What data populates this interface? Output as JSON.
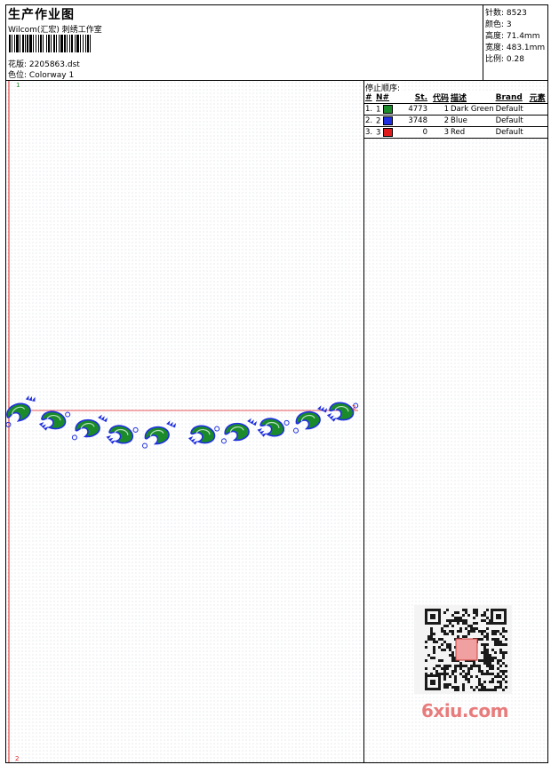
{
  "header": {
    "title": "生产作业图",
    "company": "Wilcom(汇宏) 刺绣工作室",
    "design_label": "花版:",
    "design_value": "2205863.dst",
    "colorway_label": "色位:",
    "colorway_value": "Colorway 1"
  },
  "stats": {
    "stitches": "针数: 8523",
    "colors": "颜色: 3",
    "height": "高度: 71.4mm",
    "width": "宽度: 483.1mm",
    "scale": "比例: 0.28"
  },
  "stop_sequence": {
    "label": "停止顺序:",
    "headers": [
      "#",
      "N#",
      "St.",
      "代码",
      "描述",
      "Brand",
      "元素"
    ],
    "rows": [
      {
        "index": "1.",
        "n": "1",
        "color": "#1a8a2a",
        "stitches": "4773",
        "code": "1",
        "desc": "Dark Green",
        "brand": "Default",
        "element": ""
      },
      {
        "index": "2.",
        "n": "2",
        "color": "#1f2fe0",
        "stitches": "3748",
        "code": "2",
        "desc": "Blue",
        "brand": "Default",
        "element": ""
      },
      {
        "index": "3.",
        "n": "3",
        "color": "#e01a1a",
        "stitches": "0",
        "code": "3",
        "desc": "Red",
        "brand": "Default",
        "element": ""
      }
    ]
  },
  "markers": {
    "start_top": "1",
    "start_bottom": "2",
    "end_mark": "2"
  },
  "watermark": {
    "text": "6xiu.com"
  }
}
